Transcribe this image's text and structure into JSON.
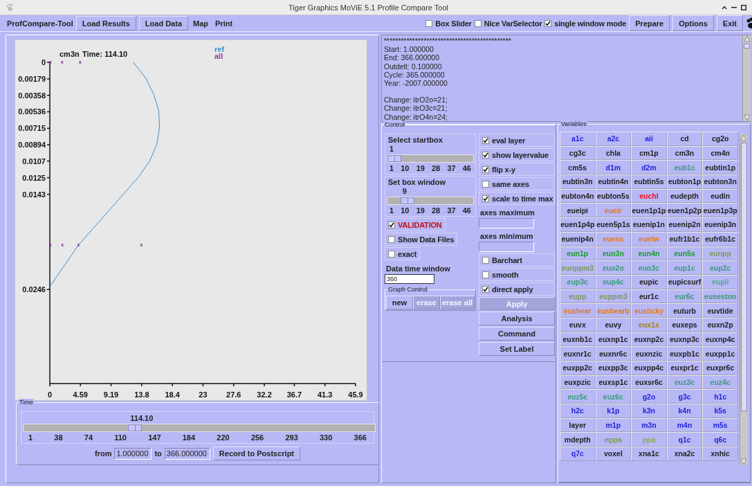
{
  "window": {
    "title": "Tiger Graphics MoViE 5.1 Profile Compare Tool"
  },
  "toolbar": {
    "app_label": "ProfCompare-Tool",
    "left_items": [
      {
        "label": "Load Results",
        "kind": "button"
      },
      {
        "label": "Load Data",
        "kind": "button"
      },
      {
        "label": "Map",
        "kind": "link"
      },
      {
        "label": "Print",
        "kind": "link"
      }
    ],
    "options": [
      {
        "label": "Box Slider",
        "checked": false
      },
      {
        "label": "Nice VarSelector",
        "checked": false
      },
      {
        "label": "single window mode",
        "checked": true
      }
    ],
    "right_buttons": [
      "Prepare",
      "Options",
      "Exit"
    ]
  },
  "plot": {
    "time_caption": "Time: 114.10",
    "chart_data": {
      "type": "line",
      "title": "cm3n",
      "x": [
        12.55,
        14.43,
        15.63,
        16.35,
        16.46,
        16.06,
        14.98,
        13.34,
        4.3,
        0,
        0.1,
        1.85,
        4.55,
        0.1,
        1.9,
        4.3,
        13.75
      ],
      "xlim": [
        0,
        45.9
      ],
      "ylim": [
        0.0348,
        0
      ],
      "xticks": [
        0,
        4.59,
        9.19,
        13.8,
        18.4,
        23,
        27.6,
        32.2,
        36.7,
        41.3,
        45.9
      ],
      "yticks": [
        0,
        0.00179,
        0.00358,
        0.00536,
        0.00715,
        0.00894,
        0.0107,
        0.0125,
        0.0143,
        0.0246
      ],
      "series": [
        {
          "name": "ref",
          "color": "#3a8fd0",
          "type": "line",
          "values": [
            0,
            0.00175,
            0.00353,
            0.00523,
            0.00706,
            0.00888,
            0.0107,
            0.0124,
            0.0198,
            0.0243,
            null,
            null,
            null,
            null,
            null,
            null,
            null
          ]
        },
        {
          "name": "all",
          "color": "#8a3a9a",
          "type": "scatter",
          "values": [
            null,
            null,
            null,
            null,
            null,
            null,
            null,
            null,
            null,
            null,
            0,
            0,
            0,
            0.0198,
            0.0198,
            0.0198,
            0.0198
          ]
        }
      ]
    }
  },
  "time_panel": {
    "title": "Time",
    "value": "114.10",
    "level": 0.31,
    "ticks": [
      "1",
      "38",
      "74",
      "110",
      "147",
      "184",
      "220",
      "256",
      "293",
      "330",
      "366"
    ],
    "from_label": "from",
    "from_value": "1.000000",
    "to_label": "to",
    "to_value": "366.000000",
    "record_button": "Record to Postscript"
  },
  "log": {
    "lines": [
      "*********************************************",
      "Start: 1.000000",
      "End: 366.000000",
      "Outdelt: 0.100000",
      "Cycle: 365.000000",
      "Year: -2007.000000",
      "Change: itrO2o=21;",
      "Change: itrO3c=21;",
      "Change: itrO4n=24;"
    ]
  },
  "control": {
    "title": "Control",
    "sliders": [
      {
        "label": "Select startbox",
        "value": "1",
        "level": 0,
        "ticks": [
          "1",
          "10",
          "19",
          "28",
          "37",
          "46"
        ]
      },
      {
        "label": "Set box window",
        "value": "9",
        "level": 0.18,
        "ticks": [
          "1",
          "10",
          "19",
          "28",
          "37",
          "46"
        ]
      }
    ],
    "left_checks": [
      {
        "label": "VALIDATION",
        "checked": true,
        "kind": "alert"
      },
      {
        "label": "Show Data Files",
        "checked": false,
        "kind": "plain"
      },
      {
        "label": "exact",
        "checked": false,
        "kind": "plain"
      }
    ],
    "time_window": {
      "label": "Data time window",
      "value": "360"
    },
    "graph_control": {
      "title": "Graph Control",
      "buttons": [
        {
          "label": "new",
          "disabled": false
        },
        {
          "label": "erase",
          "disabled": true
        },
        {
          "label": "erase all",
          "disabled": true
        }
      ]
    },
    "right_checks": [
      {
        "label": "eval layer",
        "checked": true
      },
      {
        "label": "show layervalue",
        "checked": true
      },
      {
        "label": "flip x-y",
        "checked": true
      },
      {
        "label": "same axes",
        "checked": false
      },
      {
        "label": "scale to time max",
        "checked": true
      }
    ],
    "axes_fields": [
      {
        "label": "axes maximum"
      },
      {
        "label": "axes minimum"
      }
    ],
    "right_checks_2": [
      {
        "label": "Barchart",
        "checked": false
      },
      {
        "label": "smooth",
        "checked": false
      },
      {
        "label": "direct apply",
        "checked": true
      }
    ],
    "actions": [
      {
        "label": "Apply",
        "disabled": true
      },
      {
        "label": "Analysis",
        "disabled": false
      },
      {
        "label": "Command",
        "disabled": false
      },
      {
        "label": "Set Label",
        "disabled": false
      }
    ]
  },
  "variables": {
    "title": "Variables",
    "items": [
      {
        "label": "a1c",
        "color": "#2323d8"
      },
      {
        "label": "a2c",
        "color": "#2323d8"
      },
      {
        "label": "aii",
        "color": "#2323d8"
      },
      {
        "label": "cd",
        "color": "#222222"
      },
      {
        "label": "cg2o",
        "color": "#222222"
      },
      {
        "label": "cg3c",
        "color": "#222222"
      },
      {
        "label": "chla",
        "color": "#222222"
      },
      {
        "label": "cm1p",
        "color": "#222222"
      },
      {
        "label": "cm3n",
        "color": "#222222"
      },
      {
        "label": "cm4n",
        "color": "#222222"
      },
      {
        "label": "cm5s",
        "color": "#222222"
      },
      {
        "label": "d1m",
        "color": "#2323d8"
      },
      {
        "label": "d2m",
        "color": "#2323d8"
      },
      {
        "label": "eub1c",
        "color": "#3a9a78"
      },
      {
        "label": "eubtin1p",
        "color": "#222222"
      },
      {
        "label": "eubtin3n",
        "color": "#222222"
      },
      {
        "label": "eubtin4n",
        "color": "#222222"
      },
      {
        "label": "eubtin5s",
        "color": "#222222"
      },
      {
        "label": "eubton1p",
        "color": "#222222"
      },
      {
        "label": "eubton3n",
        "color": "#222222"
      },
      {
        "label": "eubton4n",
        "color": "#222222"
      },
      {
        "label": "eubton5s",
        "color": "#222222"
      },
      {
        "label": "euchl",
        "color": "#e81020"
      },
      {
        "label": "eudepth",
        "color": "#222222"
      },
      {
        "label": "eudin",
        "color": "#222222"
      },
      {
        "label": "eueipi",
        "color": "#222222"
      },
      {
        "label": "eueir",
        "color": "#e07a20"
      },
      {
        "label": "euen1p1p",
        "color": "#222222"
      },
      {
        "label": "euen1p2p",
        "color": "#222222"
      },
      {
        "label": "euen1p3p",
        "color": "#222222"
      },
      {
        "label": "euen1p4p",
        "color": "#222222"
      },
      {
        "label": "euen5p1s",
        "color": "#222222"
      },
      {
        "label": "euenip1n",
        "color": "#222222"
      },
      {
        "label": "euenip2n",
        "color": "#222222"
      },
      {
        "label": "euenip3n",
        "color": "#222222"
      },
      {
        "label": "euenip4n",
        "color": "#222222"
      },
      {
        "label": "euess",
        "color": "#e07a20"
      },
      {
        "label": "euetw",
        "color": "#e07a20"
      },
      {
        "label": "eufr1b1c",
        "color": "#222222"
      },
      {
        "label": "eufr6b1c",
        "color": "#222222"
      },
      {
        "label": "eun1p",
        "color": "#1a9a2a"
      },
      {
        "label": "eun3n",
        "color": "#1a9a2a"
      },
      {
        "label": "eun4n",
        "color": "#1a9a2a"
      },
      {
        "label": "eun5s",
        "color": "#1a9a2a"
      },
      {
        "label": "eunpp",
        "color": "#7a9a5a"
      },
      {
        "label": "eunppm3",
        "color": "#7a9a5a"
      },
      {
        "label": "euo2o",
        "color": "#3a9a78"
      },
      {
        "label": "euo3c",
        "color": "#3a9a78"
      },
      {
        "label": "eup1c",
        "color": "#3a9a78"
      },
      {
        "label": "eup2c",
        "color": "#3a9a78"
      },
      {
        "label": "eup3c",
        "color": "#3a9a78"
      },
      {
        "label": "eup4c",
        "color": "#3a9a78"
      },
      {
        "label": "eupic",
        "color": "#222222"
      },
      {
        "label": "eupicsurf",
        "color": "#222222"
      },
      {
        "label": "eupii",
        "color": "#4aaa88"
      },
      {
        "label": "eupp",
        "color": "#7a9a5a"
      },
      {
        "label": "euppm3",
        "color": "#7a9a5a"
      },
      {
        "label": "eur1c",
        "color": "#222222"
      },
      {
        "label": "eur6c",
        "color": "#3a9a78"
      },
      {
        "label": "euseston",
        "color": "#3a9a78"
      },
      {
        "label": "eushear",
        "color": "#e07a20"
      },
      {
        "label": "eushearb",
        "color": "#e07a20"
      },
      {
        "label": "eusticky",
        "color": "#e07a20"
      },
      {
        "label": "euturb",
        "color": "#222222"
      },
      {
        "label": "euvtide",
        "color": "#222222"
      },
      {
        "label": "euvx",
        "color": "#222222"
      },
      {
        "label": "euvy",
        "color": "#222222"
      },
      {
        "label": "eux1x",
        "color": "#a88400"
      },
      {
        "label": "euxeps",
        "color": "#222222"
      },
      {
        "label": "euxn2p",
        "color": "#222222"
      },
      {
        "label": "euxnb1c",
        "color": "#222222"
      },
      {
        "label": "euxnp1c",
        "color": "#222222"
      },
      {
        "label": "euxnp2c",
        "color": "#222222"
      },
      {
        "label": "euxnp3c",
        "color": "#222222"
      },
      {
        "label": "euxnp4c",
        "color": "#222222"
      },
      {
        "label": "euxnr1c",
        "color": "#222222"
      },
      {
        "label": "euxnr6c",
        "color": "#222222"
      },
      {
        "label": "euxnzic",
        "color": "#222222"
      },
      {
        "label": "euxpb1c",
        "color": "#222222"
      },
      {
        "label": "euxpp1c",
        "color": "#222222"
      },
      {
        "label": "euxpp2c",
        "color": "#222222"
      },
      {
        "label": "euxpp3c",
        "color": "#222222"
      },
      {
        "label": "euxpp4c",
        "color": "#222222"
      },
      {
        "label": "euxpr1c",
        "color": "#222222"
      },
      {
        "label": "euxpr6c",
        "color": "#222222"
      },
      {
        "label": "euxpzic",
        "color": "#222222"
      },
      {
        "label": "euxsp1c",
        "color": "#222222"
      },
      {
        "label": "euxsr6c",
        "color": "#222222"
      },
      {
        "label": "euz3c",
        "color": "#3a9a78"
      },
      {
        "label": "euz4c",
        "color": "#3a9a78"
      },
      {
        "label": "euz5c",
        "color": "#3a9a78"
      },
      {
        "label": "euz6c",
        "color": "#3a9a78"
      },
      {
        "label": "g2o",
        "color": "#2323d8"
      },
      {
        "label": "g3c",
        "color": "#2323d8"
      },
      {
        "label": "h1c",
        "color": "#2323d8"
      },
      {
        "label": "h2c",
        "color": "#2323d8"
      },
      {
        "label": "k1p",
        "color": "#2323d8"
      },
      {
        "label": "k3n",
        "color": "#2323d8"
      },
      {
        "label": "k4n",
        "color": "#2323d8"
      },
      {
        "label": "k5s",
        "color": "#2323d8"
      },
      {
        "label": "layer",
        "color": "#222222"
      },
      {
        "label": "m1p",
        "color": "#2323d8"
      },
      {
        "label": "m3n",
        "color": "#2323d8"
      },
      {
        "label": "m4n",
        "color": "#2323d8"
      },
      {
        "label": "m5s",
        "color": "#2323d8"
      },
      {
        "label": "mdepth",
        "color": "#222222"
      },
      {
        "label": "nppa",
        "color": "#7a9a5a"
      },
      {
        "label": "ppa",
        "color": "#8aaa50"
      },
      {
        "label": "q1c",
        "color": "#2323d8"
      },
      {
        "label": "q6c",
        "color": "#2323d8"
      },
      {
        "label": "q7c",
        "color": "#2323d8"
      },
      {
        "label": "voxel",
        "color": "#222222"
      },
      {
        "label": "xna1c",
        "color": "#222222"
      },
      {
        "label": "xna2c",
        "color": "#222222"
      },
      {
        "label": "xnhic",
        "color": "#222222"
      }
    ]
  }
}
